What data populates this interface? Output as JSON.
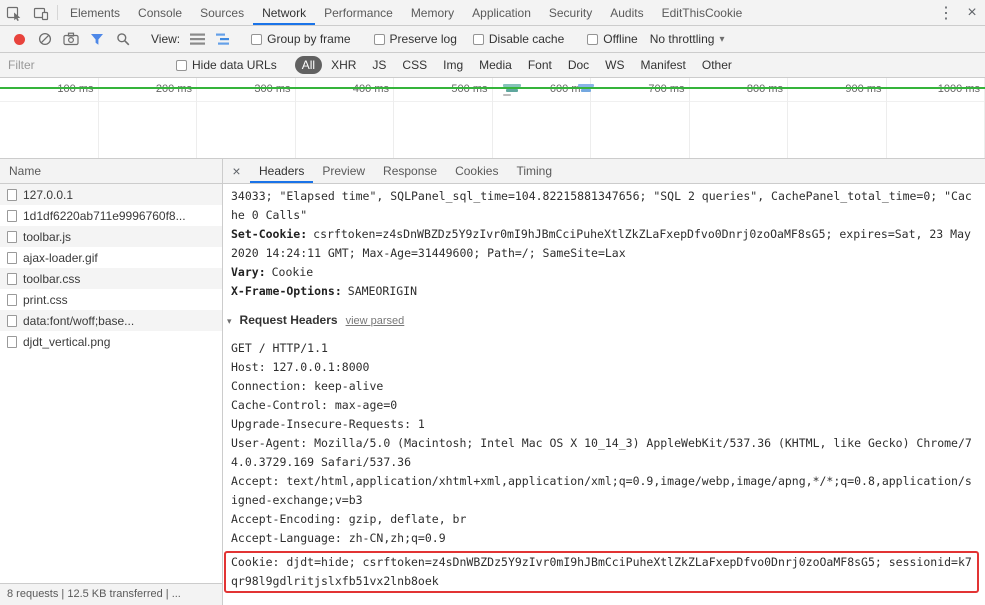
{
  "window": {
    "menu_icon": "⋮",
    "close_icon": "×"
  },
  "tabbar": {
    "tabs": [
      "Elements",
      "Console",
      "Sources",
      "Network",
      "Performance",
      "Memory",
      "Application",
      "Security",
      "Audits",
      "EditThisCookie"
    ],
    "active_tab": "Network"
  },
  "toolbar": {
    "view_label": "View:",
    "group_by_frame": "Group by frame",
    "preserve_log": "Preserve log",
    "disable_cache": "Disable cache",
    "offline": "Offline",
    "throttling": "No throttling",
    "dropdown_icon": "▾"
  },
  "filterbar": {
    "filter_placeholder": "Filter",
    "hide_data_urls": "Hide data URLs",
    "pills": [
      "All",
      "XHR",
      "JS",
      "CSS",
      "Img",
      "Media",
      "Font",
      "Doc",
      "WS",
      "Manifest",
      "Other"
    ],
    "active_pill": "All"
  },
  "timeline": {
    "ticks": [
      "100 ms",
      "200 ms",
      "300 ms",
      "400 ms",
      "500 ms",
      "600 ms",
      "700 ms",
      "800 ms",
      "900 ms",
      "1000 ms"
    ]
  },
  "requests": {
    "column_header": "Name",
    "items": [
      {
        "name": "127.0.0.1",
        "type": "document"
      },
      {
        "name": "1d1df6220ab711e9996760f8...",
        "type": "font"
      },
      {
        "name": "toolbar.js",
        "type": "script"
      },
      {
        "name": "ajax-loader.gif",
        "type": "image"
      },
      {
        "name": "toolbar.css",
        "type": "stylesheet"
      },
      {
        "name": "print.css",
        "type": "stylesheet"
      },
      {
        "name": "data:font/woff;base...",
        "type": "font"
      },
      {
        "name": "djdt_vertical.png",
        "type": "image"
      }
    ]
  },
  "details": {
    "close_icon": "×",
    "tabs": [
      "Headers",
      "Preview",
      "Response",
      "Cookies",
      "Timing"
    ],
    "active_tab": "Headers",
    "overflow_line": "34033; \"Elapsed time\", SQLPanel_sql_time=104.82215881347656; \"SQL 2 queries\", CachePanel_total_time=0; \"Cache 0 Calls\"",
    "response_headers": [
      {
        "name": "Set-Cookie:",
        "value": "csrftoken=z4sDnWBZDz5Y9zIvr0mI9hJBmCciPuheXtlZkZLaFxepDfvo0Dnrj0zoOaMF8sG5; expires=Sat, 23 May 2020 14:24:11 GMT; Max-Age=31449600; Path=/; SameSite=Lax"
      },
      {
        "name": "Vary:",
        "value": "Cookie"
      },
      {
        "name": "X-Frame-Options:",
        "value": "SAMEORIGIN"
      }
    ],
    "request_headers_section": {
      "disclosure_icon": "▾",
      "title": "Request Headers",
      "view_parsed_link": "view parsed"
    },
    "raw_request_lines": [
      "GET / HTTP/1.1",
      "Host: 127.0.0.1:8000",
      "Connection: keep-alive",
      "Cache-Control: max-age=0",
      "Upgrade-Insecure-Requests: 1",
      "User-Agent: Mozilla/5.0 (Macintosh; Intel Mac OS X 10_14_3) AppleWebKit/537.36 (KHTML, like Gecko) Chrome/74.0.3729.169 Safari/537.36",
      "Accept: text/html,application/xhtml+xml,application/xml;q=0.9,image/webp,image/apng,*/*;q=0.8,application/signed-exchange;v=b3",
      "Accept-Encoding: gzip, deflate, br",
      "Accept-Language: zh-CN,zh;q=0.9"
    ],
    "highlighted_cookie_line": "Cookie: djdt=hide; csrftoken=z4sDnWBZDz5Y9zIvr0mI9hJBmCciPuheXtlZkZLaFxepDfvo0Dnrj0zoOaMF8sG5; sessionid=k7qr98l9gdlritjslxfb51vx2lnb8oek"
  },
  "statusbar": {
    "summary": "8 requests | 12.5 KB transferred | ..."
  }
}
